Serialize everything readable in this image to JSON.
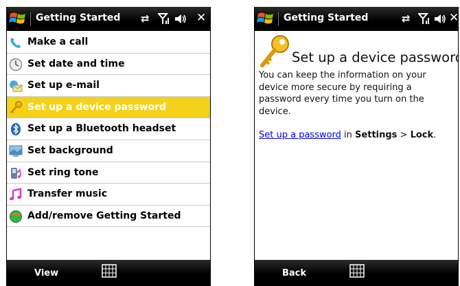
{
  "left_screen": {
    "title": "Getting Started",
    "close": "✕",
    "menu_items": [
      {
        "label": "Make a call",
        "icon": "phone-call-icon"
      },
      {
        "label": "Set date and time",
        "icon": "clock-icon"
      },
      {
        "label": "Set up e-mail",
        "icon": "email-icon"
      },
      {
        "label": "Set up a device password",
        "icon": "key-icon"
      },
      {
        "label": "Set up a Bluetooth headset",
        "icon": "bluetooth-icon"
      },
      {
        "label": "Set background",
        "icon": "wallpaper-icon"
      },
      {
        "label": "Set ring tone",
        "icon": "ring-tone-icon"
      },
      {
        "label": "Transfer music",
        "icon": "music-note-icon"
      },
      {
        "label": "Add/remove Getting Started",
        "icon": "add-remove-icon"
      }
    ],
    "selected_index": 3,
    "softkey_left": "View"
  },
  "right_screen": {
    "title": "Getting Started",
    "close": "✕",
    "heading": "Set up a device password",
    "body": "You can keep the information on your device more secure by requiring a password every time you turn on the device.",
    "link_text": "Set up a password",
    "link_mid": " in ",
    "settings": "Settings",
    "sep": " > ",
    "lock": "Lock",
    "period": ".",
    "softkey_left": "Back"
  },
  "colors": {
    "selected_highlight": "#f4d21a",
    "title_bar": "#000000",
    "link": "#0000ee"
  }
}
